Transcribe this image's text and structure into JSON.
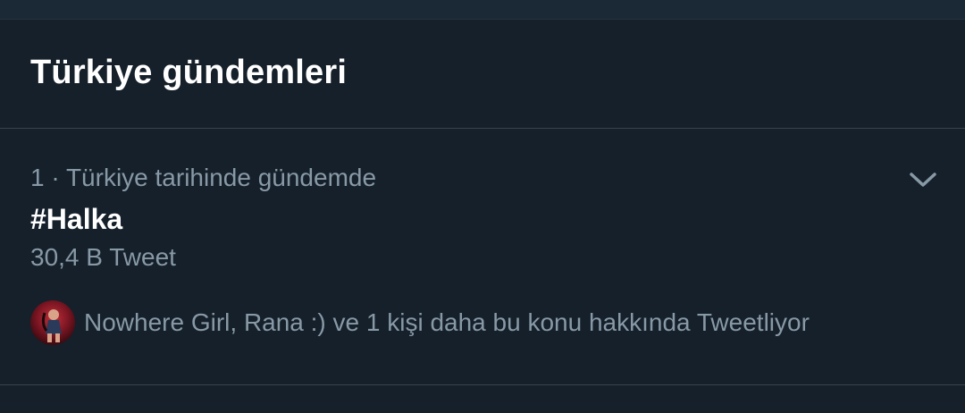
{
  "section": {
    "title": "Türkiye gündemleri"
  },
  "trend": {
    "meta": "1 · Türkiye tarihinde gündemde",
    "name": "#Halka",
    "count": "30,4 B Tweet",
    "context": "Nowhere Girl, Rana :) ve 1 kişi daha bu konu hakkında Tweetliyor",
    "menu_icon": "chevron-down-icon"
  },
  "colors": {
    "background": "#15202b",
    "divider": "#38444d",
    "secondary_text": "#8899a6",
    "primary_text": "#ffffff"
  }
}
